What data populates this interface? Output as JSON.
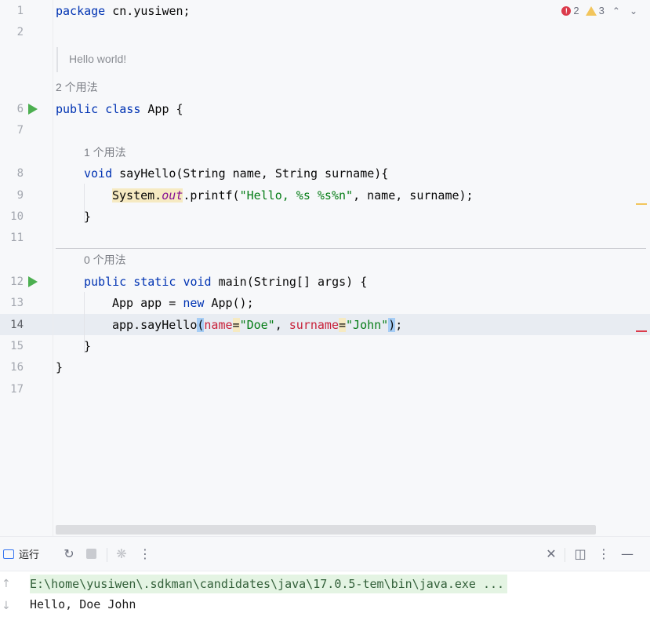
{
  "editor": {
    "line_numbers": [
      "1",
      "2",
      "6",
      "7",
      "8",
      "9",
      "10",
      "11",
      "12",
      "13",
      "14",
      "15",
      "16",
      "17"
    ],
    "inspections": {
      "errors": "2",
      "warnings": "3"
    },
    "javadoc": "Hello world!",
    "usages": {
      "class": "2 个用法",
      "sayHello": "1 个用法",
      "main": "0 个用法"
    },
    "code": {
      "l1_kw": "package",
      "l1_rest": " cn.yusiwen;",
      "l6_kw1": "public",
      "l6_kw2": "class",
      "l6_rest": " App {",
      "l8_kw": "void",
      "l8_rest": " sayHello(String name, String surname){",
      "l9_sys": "System.",
      "l9_out": "out",
      "l9_mid": ".printf(",
      "l9_str": "\"Hello, %s %s%n\"",
      "l9_end": ", name, surname);",
      "l10": "}",
      "l12_kw1": "public",
      "l12_kw2": "static",
      "l12_kw3": "void",
      "l12_rest": " main(String[] args) {",
      "l13_a": "App app = ",
      "l13_kw": "new",
      "l13_b": " App();",
      "l14_a": "app.sayHello",
      "l14_paren1": "(",
      "l14_p1": "name",
      "l14_eq1": "=",
      "l14_s1": "\"Doe\"",
      "l14_comma": ", ",
      "l14_p2": "surname",
      "l14_eq2": "=",
      "l14_s2": "\"John\"",
      "l14_paren2": ")",
      "l14_end": ";",
      "l15": "}",
      "l16": "}"
    }
  },
  "run_panel": {
    "tab_label": "运行",
    "console": {
      "command": "E:\\home\\yusiwen\\.sdkman\\candidates\\java\\17.0.5-tem\\bin\\java.exe ...",
      "output": "Hello, Doe John"
    }
  },
  "colors": {
    "keyword": "#0033b3",
    "string": "#067d17",
    "param_hint": "#c8213a",
    "error": "#db3b4b",
    "warning": "#f2c55c",
    "run_icon": "#4caf50"
  }
}
